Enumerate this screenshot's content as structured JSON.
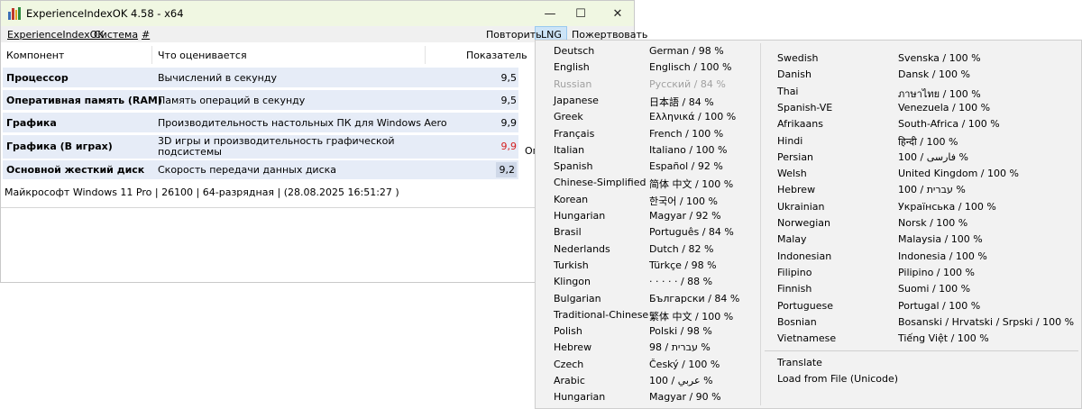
{
  "window": {
    "title": "ExperienceIndexOK 4.58 - x64",
    "minimize": "—",
    "maximize": "☐",
    "close": "✕"
  },
  "menu": {
    "app": "ExperienceIndexOK",
    "system": "Система",
    "hash": "#",
    "repeat": "Повторить",
    "lng": "LNG",
    "donate": "Пожертвовать"
  },
  "table": {
    "columns": [
      "Компонент",
      "Что оценивается",
      "Показатель"
    ],
    "rows": [
      {
        "component": "Процессор",
        "what": "Вычислений в секунду",
        "value": "9,5"
      },
      {
        "component": "Оперативная память (RAM)",
        "what": "Память операций в секунду",
        "value": "9,5"
      },
      {
        "component": "Графика",
        "what": "Производительность настольных ПК для Windows Aero",
        "value": "9,9"
      },
      {
        "component": "Графика (В играх)",
        "what": "3D игры и производительность графической",
        "what2": "подсистемы",
        "value": "9,9"
      },
      {
        "component": "Основной жесткий диск",
        "what": "Скорость передачи данных диска",
        "value": "9,2"
      }
    ],
    "overflow_text": "Ог"
  },
  "status": "Майкрософт Windows 11 Pro | 26100 | 64-разрядная | (28.08.2025 16:51:27 )",
  "colors": {
    "highlight_value": "#d42020",
    "title_bg": "#f0f7e2",
    "row_bg": "#e6ecf7"
  },
  "languages_left": [
    {
      "name": "Deutsch",
      "value": "German / 98 %"
    },
    {
      "name": "English",
      "value": "Englisch / 100 %"
    },
    {
      "name": "Russian",
      "value": "Русский / 84 %",
      "disabled": true
    },
    {
      "name": "Japanese",
      "value": "日本語 / 84 %"
    },
    {
      "name": "Greek",
      "value": "Ελληνικά / 100 %"
    },
    {
      "name": "Français",
      "value": "French / 100 %"
    },
    {
      "name": "Italian",
      "value": "Italiano / 100 %"
    },
    {
      "name": "Spanish",
      "value": "Español / 92 %"
    },
    {
      "name": "Chinese-Simplified",
      "value": "简体 中文 / 100 %"
    },
    {
      "name": "Korean",
      "value": "한국어 / 100 %"
    },
    {
      "name": "Hungarian",
      "value": "Magyar / 92 %"
    },
    {
      "name": "Brasil",
      "value": "Português / 84 %"
    },
    {
      "name": "Nederlands",
      "value": "Dutch / 82 %"
    },
    {
      "name": "Turkish",
      "value": "Türkçe / 98 %"
    },
    {
      "name": "Klingon",
      "value": "· · · · ·  / 88 %"
    },
    {
      "name": "Bulgarian",
      "value": "Български / 84 %"
    },
    {
      "name": "Traditional-Chinese",
      "value": "繁体 中文 / 100 %"
    },
    {
      "name": "Polish",
      "value": "Polski / 98 %"
    },
    {
      "name": "Hebrew",
      "value": "98 / עברית %"
    },
    {
      "name": "Czech",
      "value": "Český / 100 %"
    },
    {
      "name": "Arabic",
      "value": "100 / عربي %"
    },
    {
      "name": "Hungarian",
      "value": "Magyar / 90 %"
    }
  ],
  "languages_right": [
    {
      "name": "Swedish",
      "value": "Svenska / 100 %"
    },
    {
      "name": "Danish",
      "value": "Dansk / 100 %"
    },
    {
      "name": "Thai",
      "value": "ภาษาไทย / 100 %"
    },
    {
      "name": "Spanish-VE",
      "value": "Venezuela / 100 %"
    },
    {
      "name": "Afrikaans",
      "value": "South-Africa / 100 %"
    },
    {
      "name": "Hindi",
      "value": "हिन्दी / 100 %"
    },
    {
      "name": "Persian",
      "value": "100 / فارسی %"
    },
    {
      "name": "Welsh",
      "value": "United Kingdom / 100 %"
    },
    {
      "name": "Hebrew",
      "value": "100 / עברית %"
    },
    {
      "name": "Ukrainian",
      "value": "Українська / 100 %"
    },
    {
      "name": "Norwegian",
      "value": "Norsk / 100 %"
    },
    {
      "name": "Malay",
      "value": "Malaysia / 100 %"
    },
    {
      "name": "Indonesian",
      "value": "Indonesia / 100 %"
    },
    {
      "name": "Filipino",
      "value": "Pilipino / 100 %"
    },
    {
      "name": "Finnish",
      "value": "Suomi / 100 %"
    },
    {
      "name": "Portuguese",
      "value": "Portugal / 100 %"
    },
    {
      "name": "Bosnian",
      "value": "Bosanski / Hrvatski / Srpski / 100 %"
    },
    {
      "name": "Vietnamese",
      "value": "Tiếng Việt / 100 %"
    }
  ],
  "extra_items": [
    "Translate",
    "Load from File (Unicode)"
  ]
}
